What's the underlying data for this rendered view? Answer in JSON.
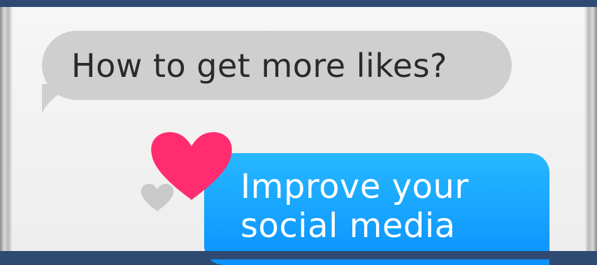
{
  "chat": {
    "incoming_message": "How to get more likes?",
    "outgoing_message_lines": [
      "Improve your",
      "social media"
    ]
  },
  "icons": {
    "reaction_big": "heart-icon",
    "reaction_small": "heart-icon"
  },
  "colors": {
    "incoming_bubble": "#cfcfcf",
    "outgoing_bubble": "#1ea7ff",
    "heart_big": "#ff2d6f",
    "heart_small": "#c9c9c9",
    "frame": "#2f4a72"
  }
}
